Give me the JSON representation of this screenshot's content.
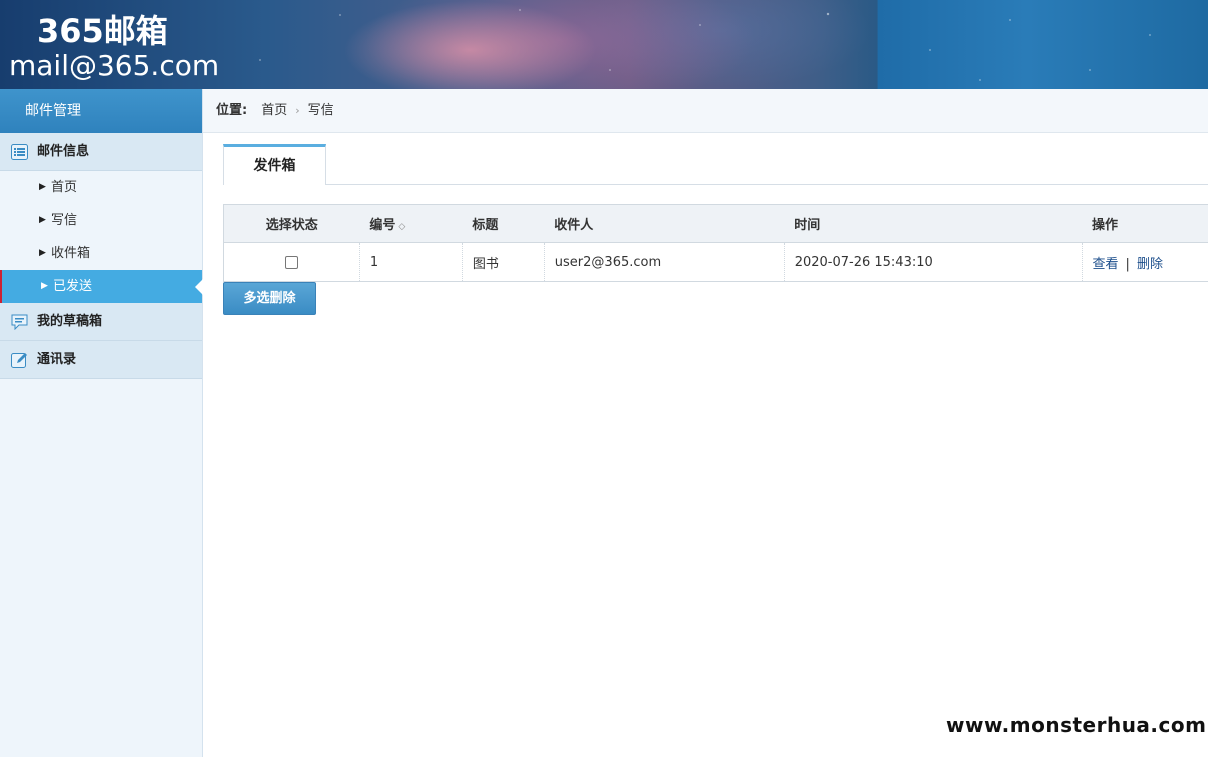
{
  "header": {
    "brand_title": "365邮箱",
    "brand_mail": "mail@365.com"
  },
  "sidebar": {
    "title": "邮件管理",
    "groups": [
      {
        "label": "邮件信息",
        "icon": "list-icon"
      },
      {
        "label": "我的草稿箱",
        "icon": "chat-icon"
      },
      {
        "label": "通讯录",
        "icon": "edit-icon"
      }
    ],
    "items": [
      {
        "label": "首页"
      },
      {
        "label": "写信"
      },
      {
        "label": "收件箱"
      },
      {
        "label": "已发送",
        "active": true
      }
    ]
  },
  "breadcrumb": {
    "prefix": "位置:",
    "path": [
      "首页",
      "写信"
    ]
  },
  "tabs": [
    {
      "label": "发件箱",
      "active": true
    }
  ],
  "table": {
    "columns": [
      "选择状态",
      "编号",
      "标题",
      "收件人",
      "时间",
      "操作"
    ],
    "rows": [
      {
        "checked": false,
        "id": "1",
        "title": "图书",
        "recipient": "user2@365.com",
        "time": "2020-07-26 15:43:10",
        "actions": [
          "查看",
          "删除"
        ]
      }
    ]
  },
  "bulk_delete_label": "多选删除",
  "watermark": "www.monsterhua.com",
  "colors": {
    "accent": "#44abe2",
    "sidebar_header": "#2f82bd",
    "link": "#1d4f8c"
  }
}
